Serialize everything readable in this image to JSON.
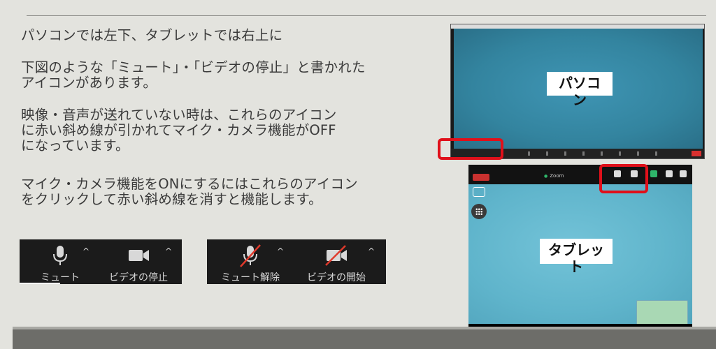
{
  "paragraphs": {
    "p1": "パソコンでは左下、タブレットでは右上に",
    "p2_line1": "下図のような「ミュート」・「ビデオの停止」と書かれた",
    "p2_line2": "アイコンがあります。",
    "p3_line1": "映像・音声が送れていない時は、これらのアイコン",
    "p3_line2": "に赤い斜め線が引かれてマイク・カメラ機能がOFF",
    "p3_line3": "になっています。",
    "p4_line1": "マイク・カメラ機能をONにするにはこれらのアイコン",
    "p4_line2": "をクリックして赤い斜め線を消すと機能します。"
  },
  "toolbar_on": {
    "mute_label": "ミュート",
    "video_label": "ビデオの停止",
    "mute_icon": "microphone-icon",
    "video_icon": "video-camera-icon"
  },
  "toolbar_off": {
    "unmute_label": "ミュート解除",
    "video_label": "ビデオの開始",
    "unmute_icon": "microphone-muted-icon",
    "video_icon": "video-camera-off-icon"
  },
  "caret": "^",
  "callouts": {
    "pc": "パソコン",
    "tablet": "タブレット"
  },
  "tablet_app": {
    "title": "Zoom"
  },
  "colors": {
    "highlight_red": "#e0101a",
    "slash_red": "#e0392b",
    "toolbar_bg": "#1b1b1b"
  }
}
